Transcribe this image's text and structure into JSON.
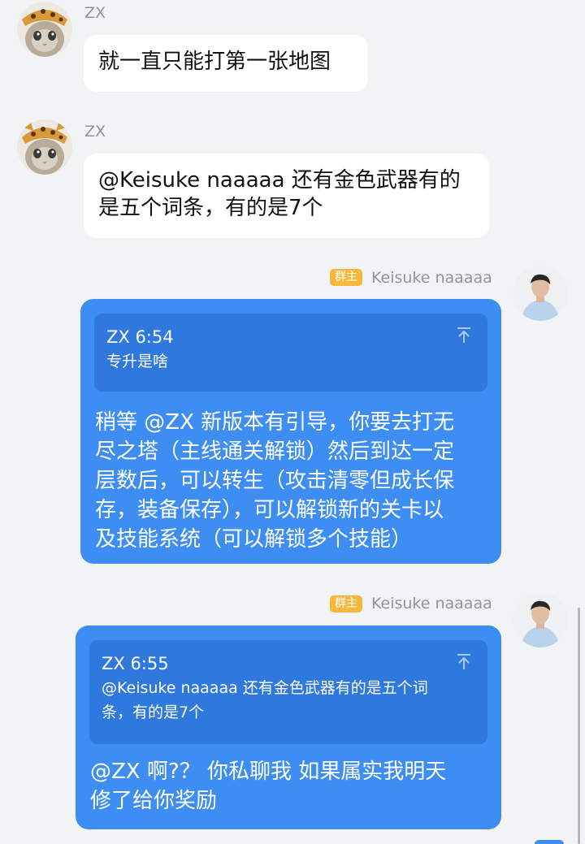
{
  "messages": [
    {
      "sender": "ZX",
      "text": "就一直只能打第一张地图"
    },
    {
      "sender": "ZX",
      "text_line1": "@Keisuke naaaaa 还有金色武器有的",
      "text_line2": "是五个词条，有的是7个"
    },
    {
      "sender": "Keisuke naaaaa",
      "role_badge": "群主",
      "quote": {
        "header": "ZX 6:54",
        "text": "专升是啥"
      },
      "reply_lines": [
        "稍等 @ZX 新版本有引导，你要去打无",
        "尽之塔（主线通关解锁）然后到达一定",
        "层数后，可以转生（攻击清零但成长保",
        "存，装备保存），可以解锁新的关卡以",
        "及技能系统（可以解锁多个技能）"
      ]
    },
    {
      "sender": "Keisuke naaaaa",
      "role_badge": "群主",
      "quote": {
        "header": "ZX 6:55",
        "text_line1": "@Keisuke naaaaa 还有金色武器有的是五个词",
        "text_line2": "条，有的是7个"
      },
      "reply_lines": [
        "@ZX 啊?？ 你私聊我  如果属实我明天",
        "修了给你奖励"
      ]
    }
  ],
  "icons": {
    "avatar_left": "cat-avatar",
    "avatar_right": "person-avatar",
    "quote_jump": "arrow-up-to-line-icon"
  },
  "colors": {
    "background": "#f2f3f5",
    "incoming_bubble": "#ffffff",
    "outgoing_bubble": "#3d8df2",
    "quote_block": "#2f78de",
    "owner_badge": "#f5b83d"
  }
}
